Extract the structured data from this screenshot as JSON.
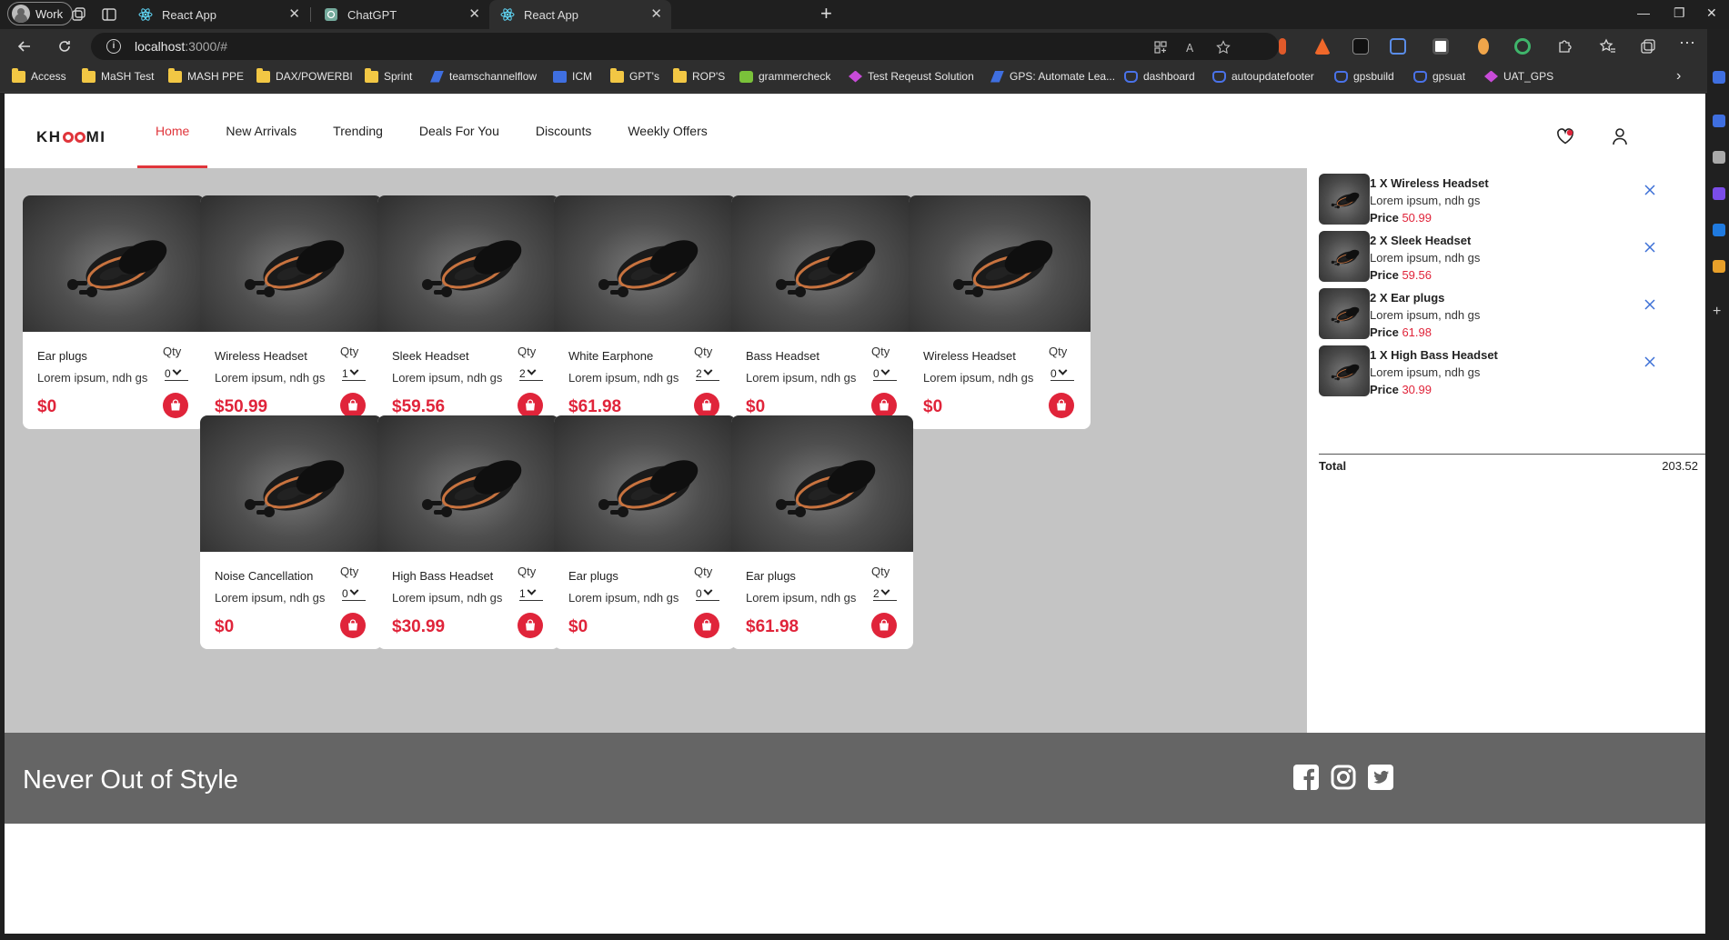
{
  "browser": {
    "profile_label": "Work",
    "tabs": [
      {
        "label": "React App",
        "active": false
      },
      {
        "label": "ChatGPT",
        "active": false
      },
      {
        "label": "React App",
        "active": true
      }
    ],
    "url_host": "localhost",
    "url_rest": ":3000/#",
    "bookmarks": [
      {
        "label": "Access",
        "icon": "folder"
      },
      {
        "label": "MaSH Test",
        "icon": "folder"
      },
      {
        "label": "MASH PPE",
        "icon": "folder"
      },
      {
        "label": "DAX/POWERBI",
        "icon": "folder"
      },
      {
        "label": "Sprint",
        "icon": "folder"
      },
      {
        "label": "teamschannelflow",
        "icon": "arrow"
      },
      {
        "label": "ICM",
        "icon": "icm"
      },
      {
        "label": "GPT's",
        "icon": "folder"
      },
      {
        "label": "ROP'S",
        "icon": "folder"
      },
      {
        "label": "grammercheck",
        "icon": "check"
      },
      {
        "label": "Test Reqeust Solution",
        "icon": "diamond"
      },
      {
        "label": "GPS: Automate Lea...",
        "icon": "arrow"
      },
      {
        "label": "dashboard",
        "icon": "cloud"
      },
      {
        "label": "autoupdatefooter",
        "icon": "cloud"
      },
      {
        "label": "gpsbuild",
        "icon": "cloud"
      },
      {
        "label": "gpsuat",
        "icon": "cloud"
      },
      {
        "label": "UAT_GPS",
        "icon": "diamond"
      }
    ]
  },
  "app": {
    "logo": {
      "pre": "KH",
      "post": "MI"
    },
    "menu": [
      {
        "label": "Home",
        "active": true
      },
      {
        "label": "New Arrivals",
        "active": false
      },
      {
        "label": "Trending",
        "active": false
      },
      {
        "label": "Deals For You",
        "active": false
      },
      {
        "label": "Discounts",
        "active": false
      },
      {
        "label": "Weekly Offers",
        "active": false
      }
    ],
    "accent_color": "#e0243a",
    "products": [
      {
        "title": "Ear plugs",
        "desc": "Lorem ipsum, ndh gs",
        "qty_label": "Qty",
        "qty": "0",
        "price": "$0"
      },
      {
        "title": "Wireless Headset",
        "desc": "Lorem ipsum, ndh gs",
        "qty_label": "Qty",
        "qty": "1",
        "price": "$50.99"
      },
      {
        "title": "Sleek Headset",
        "desc": "Lorem ipsum, ndh gs",
        "qty_label": "Qty",
        "qty": "2",
        "price": "$59.56"
      },
      {
        "title": "White Earphone",
        "desc": "Lorem ipsum, ndh gs",
        "qty_label": "Qty",
        "qty": "2",
        "price": "$61.98"
      },
      {
        "title": "Bass Headset",
        "desc": "Lorem ipsum, ndh gs",
        "qty_label": "Qty",
        "qty": "0",
        "price": "$0"
      },
      {
        "title": "Wireless Headset",
        "desc": "Lorem ipsum, ndh gs",
        "qty_label": "Qty",
        "qty": "0",
        "price": "$0"
      },
      {
        "title": "Noise Cancellation",
        "desc": "Lorem ipsum, ndh gs",
        "qty_label": "Qty",
        "qty": "0",
        "price": "$0"
      },
      {
        "title": "High Bass Headset",
        "desc": "Lorem ipsum, ndh gs",
        "qty_label": "Qty",
        "qty": "1",
        "price": "$30.99"
      },
      {
        "title": "Ear plugs",
        "desc": "Lorem ipsum, ndh gs",
        "qty_label": "Qty",
        "qty": "0",
        "price": "$0"
      },
      {
        "title": "Ear plugs",
        "desc": "Lorem ipsum, ndh gs",
        "qty_label": "Qty",
        "qty": "2",
        "price": "$61.98"
      }
    ],
    "cart": {
      "items": [
        {
          "title": "1 X Wireless Headset",
          "desc": "Lorem ipsum, ndh gs",
          "price_label": "Price",
          "price": "50.99"
        },
        {
          "title": "2 X Sleek Headset",
          "desc": "Lorem ipsum, ndh gs",
          "price_label": "Price",
          "price": "59.56"
        },
        {
          "title": "2 X Ear plugs",
          "desc": "Lorem ipsum, ndh gs",
          "price_label": "Price",
          "price": "61.98"
        },
        {
          "title": "1 X High Bass Headset",
          "desc": "Lorem ipsum, ndh gs",
          "price_label": "Price",
          "price": "30.99"
        }
      ],
      "total_label": "Total",
      "total_value": "203.52"
    },
    "footer": {
      "slogan": "Never Out of Style",
      "social": [
        "facebook-icon",
        "instagram-icon",
        "twitter-icon"
      ]
    }
  }
}
